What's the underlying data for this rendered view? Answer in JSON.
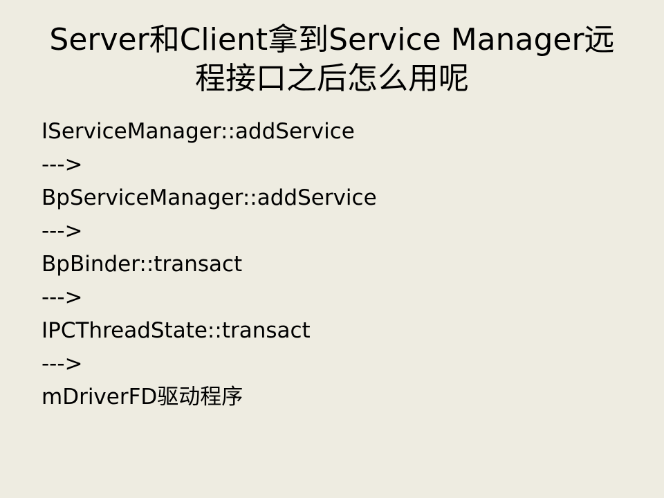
{
  "slide": {
    "title_lines": [
      "Server和Client拿到Service Manager远",
      "程接口之后怎么用呢"
    ],
    "body_lines": [
      "IServiceManager::addService",
      "--->",
      "BpServiceManager::addService",
      "--->",
      "BpBinder::transact",
      "--->",
      "IPCThreadState::transact",
      "--->",
      "mDriverFD驱动程序"
    ]
  },
  "colors": {
    "background": "#eeece1",
    "text": "#000000"
  }
}
